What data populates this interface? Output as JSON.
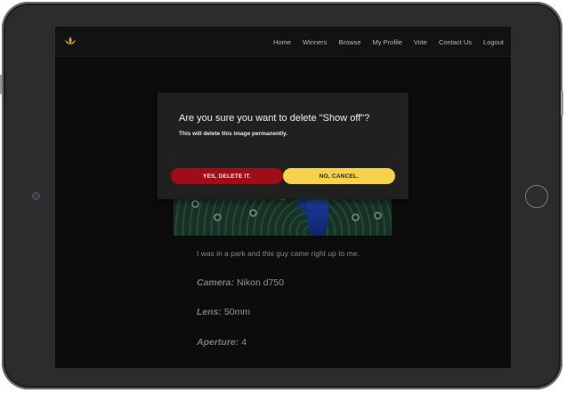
{
  "nav": {
    "links": [
      "Home",
      "Winners",
      "Browse",
      "My Profile",
      "Vote",
      "Contact Us",
      "Logout"
    ]
  },
  "image": {
    "description": "I was in a park and this guy came right up to me."
  },
  "specs": [
    {
      "label": "Camera:",
      "value": "Nikon d750"
    },
    {
      "label": "Lens:",
      "value": "50mm"
    },
    {
      "label": "Aperture:",
      "value": "4"
    }
  ],
  "modal": {
    "title": "Are you sure you want to delete \"Show off\"?",
    "subtitle": "This will delete this image permanently.",
    "confirm_label": "YES, DELETE IT.",
    "cancel_label": "NO, CANCEL."
  },
  "colors": {
    "danger": "#a00d16",
    "warning": "#f7d14a",
    "logo": "#c9a227"
  },
  "icons": {
    "logo": "lotus-icon",
    "home_button": "home-button",
    "camera": "camera-icon"
  }
}
